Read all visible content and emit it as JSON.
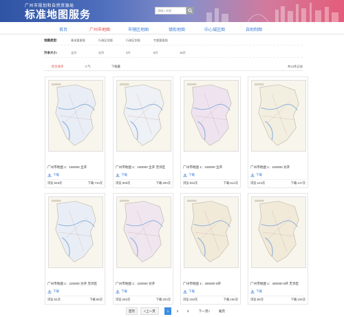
{
  "header": {
    "subtitle": "广州市规划和自然资源局",
    "title": "标准地图服务",
    "search_placeholder": "请输入关键"
  },
  "nav": [
    "首页",
    "广州市地图",
    "市辖区地图",
    "镇街地图",
    "中心城区图",
    "自助制图"
  ],
  "nav_active_index": 1,
  "filters": {
    "type": {
      "label": "地图类型:",
      "options": [
        "基本要素版",
        "行政区划版",
        "行政区划版",
        "专题要素版"
      ]
    },
    "size": {
      "label": "开本大小:",
      "options": [
        "全开",
        "对开",
        "4开",
        "8开",
        "16开"
      ]
    }
  },
  "sort": {
    "options": [
      "综合排序",
      "人气",
      "下载量"
    ],
    "active_index": 0,
    "record_count": "共16条记录"
  },
  "cards": [
    {
      "title": "广州市地图 1：150000 全开",
      "download": "下载",
      "views": "浏览:948次",
      "downloads": "下载:710次"
    },
    {
      "title": "广州市地图 1：150000 全开 无邻区",
      "download": "下载",
      "views": "浏览:308次",
      "downloads": "下载:293次"
    },
    {
      "title": "广州市地图 1：150000 全开",
      "download": "下载",
      "views": "浏览:932次",
      "downloads": "下载:614次"
    },
    {
      "title": "广州市地图 1：220000 对开",
      "download": "下载",
      "views": "浏览:124次",
      "downloads": "下载:147次"
    },
    {
      "title": "广州市地图 1：220000 对开 无邻区",
      "download": "下载",
      "views": "浏览:54次",
      "downloads": "下载:98次"
    },
    {
      "title": "广州市地图 1：220000 对开",
      "download": "下载",
      "views": "浏览:282次",
      "downloads": "下载:203次"
    },
    {
      "title": "广州市地图 1：450000 8开",
      "download": "下载",
      "views": "浏览:150次",
      "downloads": "下载:160次"
    },
    {
      "title": "广州市地图 1：450000 8开 无邻区",
      "download": "下载",
      "views": "浏览:69次",
      "downloads": "下载:106次"
    }
  ],
  "pagination": {
    "first": "首页",
    "prev": "<上一页",
    "pages": [
      "1",
      "2",
      "3"
    ],
    "active_page": "1",
    "next": "下一页>",
    "last": "尾页"
  },
  "colors": {
    "accent_blue": "#3d7fd9",
    "accent_red": "#e24b4b",
    "banner_left": "#2f54a3",
    "banner_right": "#e45c7a"
  },
  "icons": {
    "search": "search-icon",
    "download": "download-icon"
  }
}
